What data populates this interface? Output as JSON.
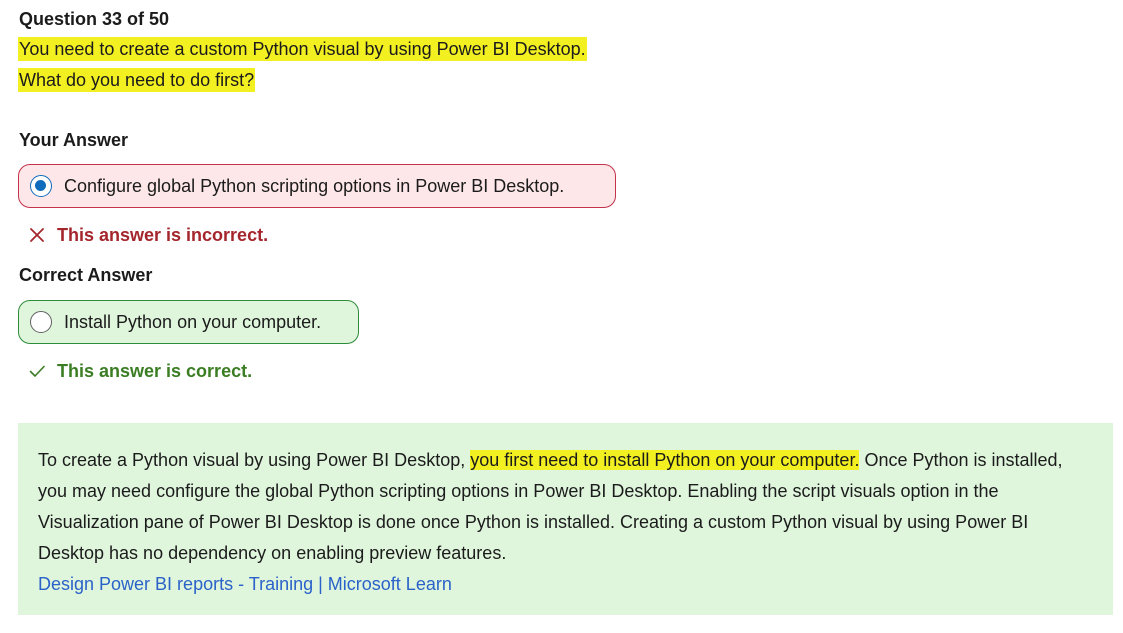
{
  "question": {
    "header": "Question 33 of 50",
    "line1": "You need to create a custom Python visual by using Power BI Desktop.",
    "line2": "What do you need to do first?"
  },
  "your_answer": {
    "label": "Your Answer",
    "option_text": "Configure global Python scripting options in Power BI Desktop.",
    "feedback": "This answer is incorrect."
  },
  "correct_answer": {
    "label": "Correct Answer",
    "option_text": "Install Python on your computer.",
    "feedback": "This answer is correct."
  },
  "explanation": {
    "text_before": "To create a Python visual by using Power BI Desktop, ",
    "highlight": "you first need to install Python on your computer.",
    "text_after": " Once Python is installed, you may need configure the global Python scripting options in Power BI Desktop. Enabling the script visuals option in the Visualization pane of Power BI Desktop is done once Python is installed. Creating a custom Python visual by using Power BI Desktop has no dependency on enabling preview features.",
    "link_text": "Design Power BI reports - Training | Microsoft Learn"
  },
  "colors": {
    "highlight": "#f3f022",
    "incorrect_border": "#c4314b",
    "incorrect_bg": "#fde7e9",
    "correct_border": "#2e8b3a",
    "correct_bg": "#dff6dd",
    "incorrect_text": "#a4262c",
    "correct_text": "#3b7d23",
    "link": "#2a62c9",
    "radio_selected": "#0f6cbd"
  },
  "icons": {
    "incorrect": "close-icon",
    "correct": "checkmark-icon"
  }
}
